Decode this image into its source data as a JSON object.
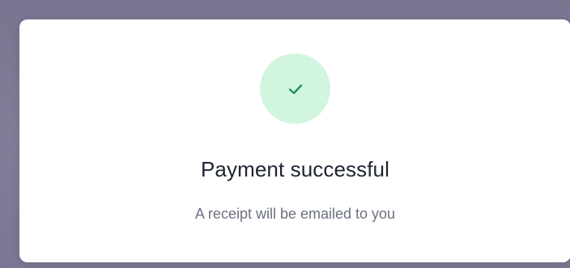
{
  "dialog": {
    "title": "Payment successful",
    "message": "A receipt will be emailed to you",
    "status_icon": "check-icon"
  },
  "colors": {
    "success_bg": "#d1f5df",
    "success_check": "#22915a",
    "title_text": "#1f2433",
    "message_text": "#6b7180",
    "backdrop": "#7b7896"
  }
}
